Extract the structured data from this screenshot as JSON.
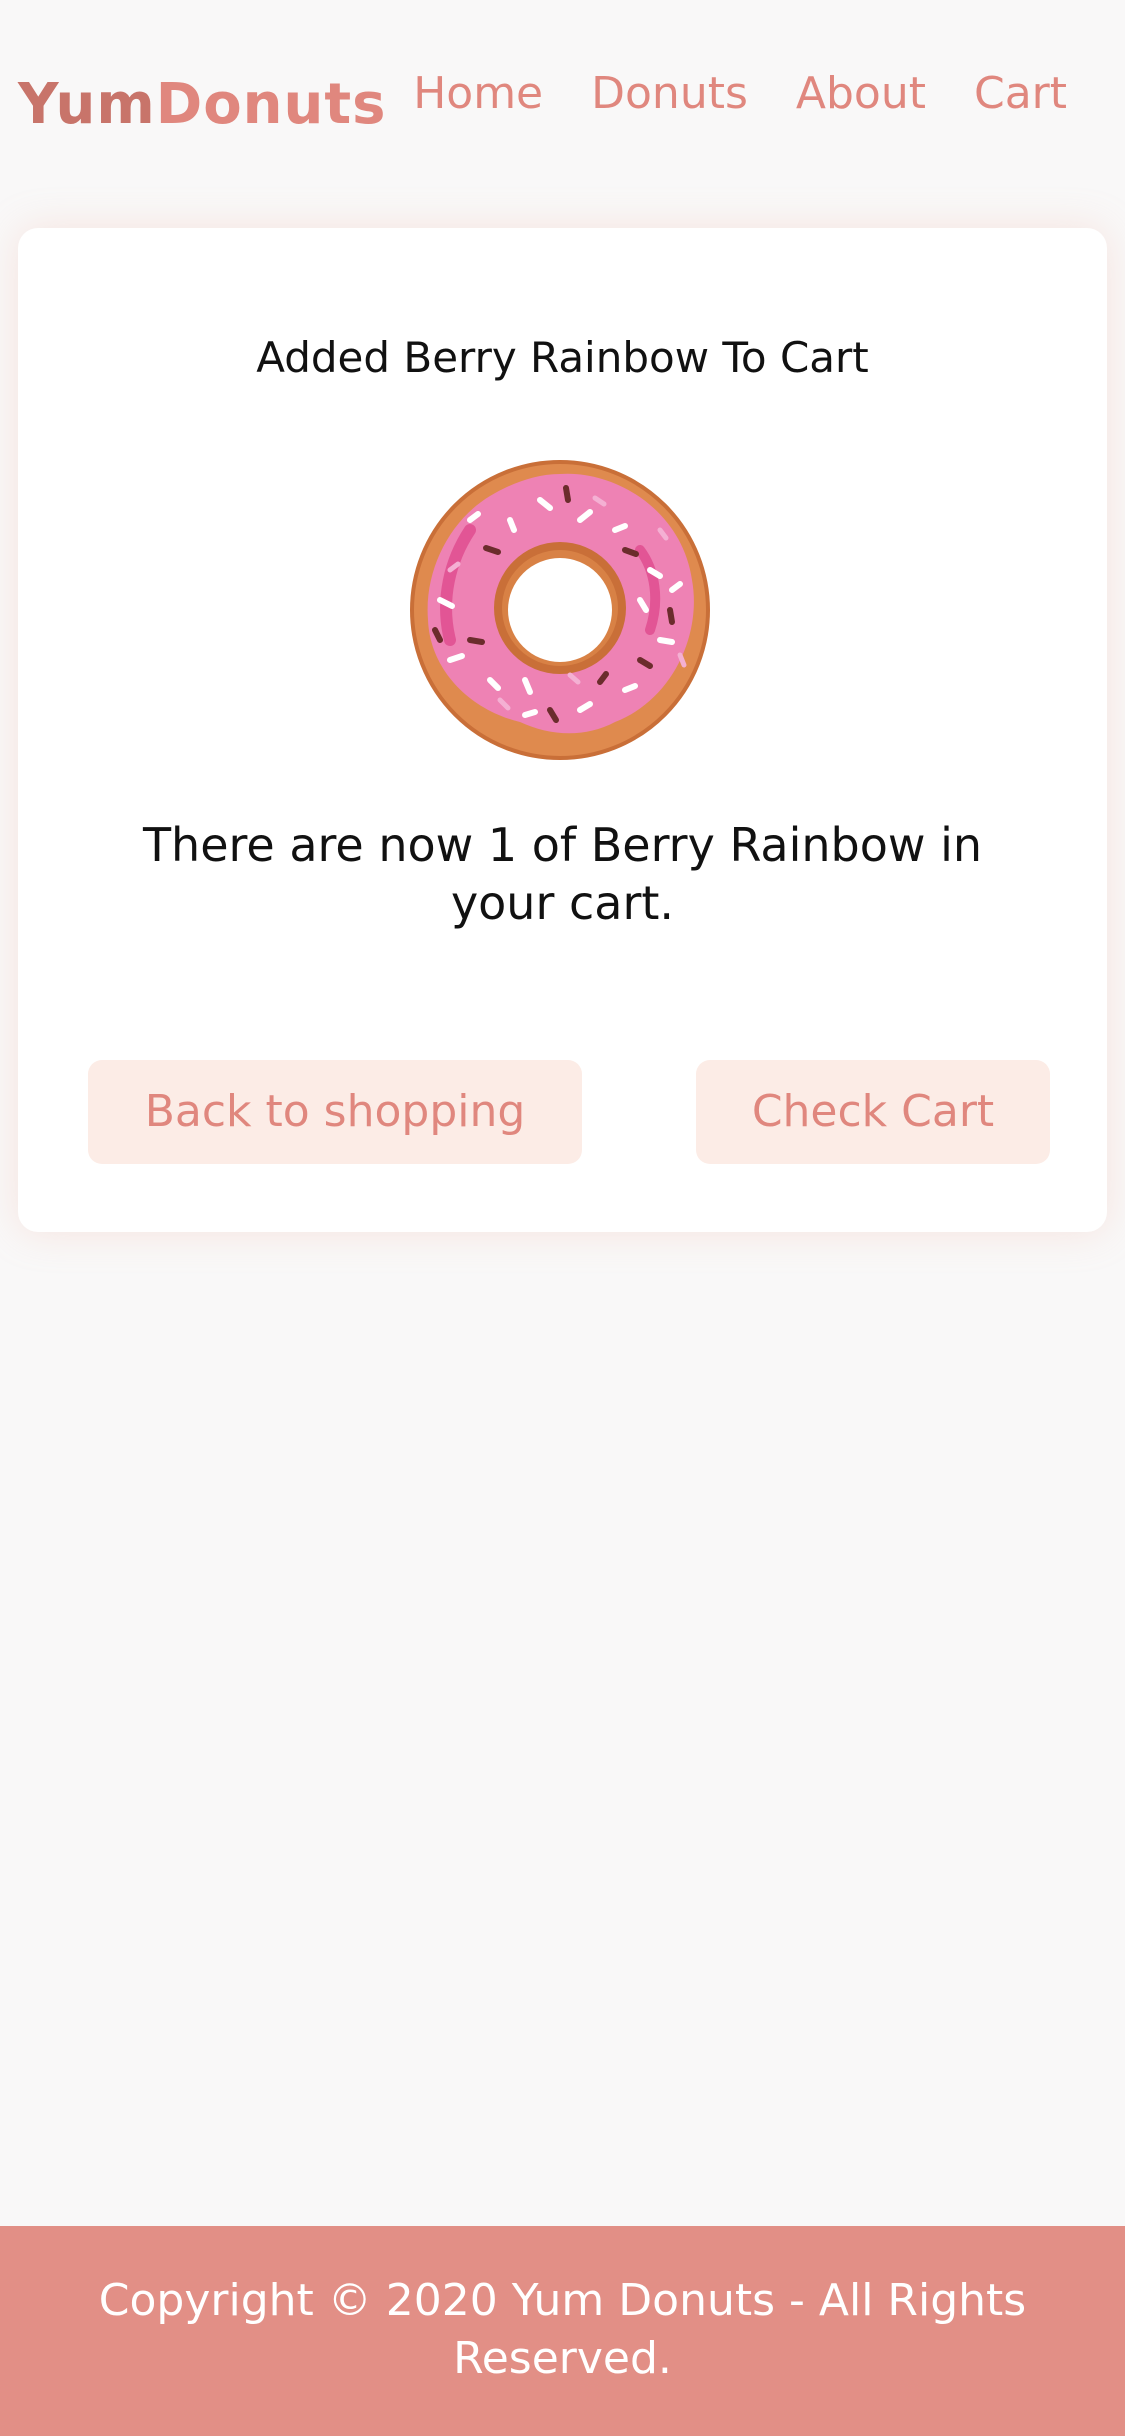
{
  "brand": {
    "name_part1": "Yum",
    "name_part2": "Donuts"
  },
  "nav": {
    "items": [
      {
        "label": "Home"
      },
      {
        "label": "Donuts"
      },
      {
        "label": "About"
      },
      {
        "label": "Cart"
      }
    ]
  },
  "confirmation": {
    "title": "Added Berry Rainbow To Cart",
    "message": "There are now 1 of Berry Rainbow in your cart.",
    "image_icon": "donut-illustration"
  },
  "actions": {
    "back_label": "Back to shopping",
    "cart_label": "Check Cart"
  },
  "footer": {
    "copyright": "Copyright © 2020 Yum Donuts - All Rights Reserved."
  },
  "colors": {
    "accent": "#e0877e",
    "brand_dark": "#c8746a",
    "button_bg": "#fcece6",
    "footer_bg": "#e28f86",
    "page_bg": "#f9f8f8"
  }
}
